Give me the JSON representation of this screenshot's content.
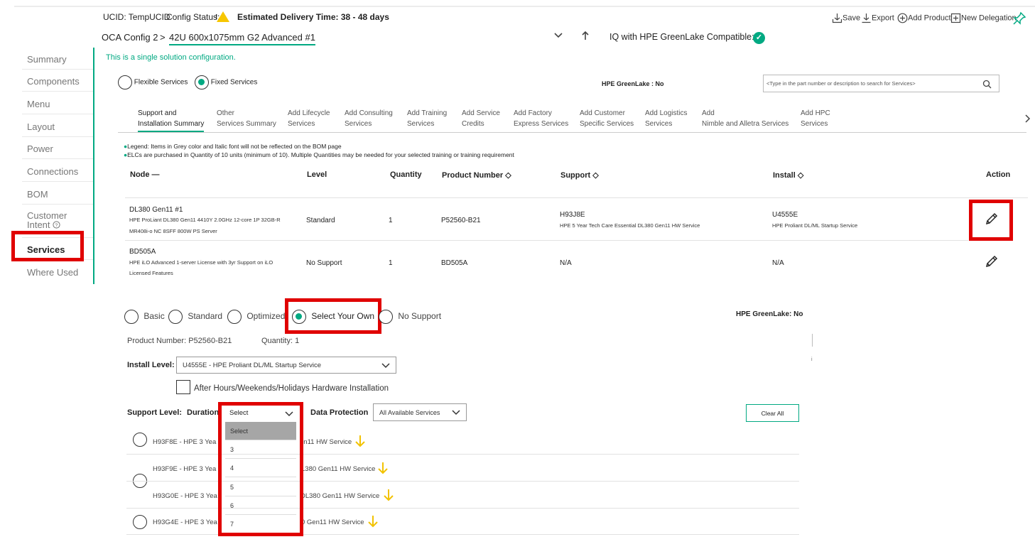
{
  "header": {
    "ucid_label": "UCID: TempUCID",
    "config_status_label": "Config Status:",
    "delivery_label": "Estimated Delivery Time: 38 - 48 days",
    "config_name": "OCA Config 2",
    "breadcrumb_sep": ">",
    "rack_name": "42U 600x1075mm G2 Advanced #1",
    "iq_label": "IQ with HPE GreenLake Compatible:",
    "single_solution_note": "This is a single solution configuration.",
    "toolbar": {
      "save": "Save",
      "export": "Export",
      "add_product": "Add Product",
      "new_delegation": "New Delegation"
    }
  },
  "sidebar": {
    "items": [
      {
        "label": "Summary"
      },
      {
        "label": "Components"
      },
      {
        "label": "Menu"
      },
      {
        "label": "Layout"
      },
      {
        "label": "Power"
      },
      {
        "label": "Connections"
      },
      {
        "label": "BOM"
      },
      {
        "label": "Customer",
        "label2": "Intent"
      },
      {
        "label": "Services"
      },
      {
        "label": "Where Used"
      }
    ]
  },
  "services": {
    "flexible_label": "Flexible Services",
    "fixed_label": "Fixed Services",
    "greenlake_label": "HPE GreenLake : No",
    "search_placeholder": "<Type in the part number or description to search for Services>",
    "tabs": [
      {
        "l1": "Support and",
        "l2": "Installation Summary"
      },
      {
        "l1": "Other",
        "l2": "Services Summary"
      },
      {
        "l1": "Add Lifecycle",
        "l2": "Services"
      },
      {
        "l1": "Add Consulting",
        "l2": "Services"
      },
      {
        "l1": "Add Training",
        "l2": "Services"
      },
      {
        "l1": "Add Service",
        "l2": "Credits"
      },
      {
        "l1": "Add Factory",
        "l2": "Express Services"
      },
      {
        "l1": "Add Customer",
        "l2": "Specific Services"
      },
      {
        "l1": "Add Logistics",
        "l2": "Services"
      },
      {
        "l1": "Add",
        "l2": "Nimble and Alletra Services"
      },
      {
        "l1": "Add HPC",
        "l2": "Services"
      }
    ],
    "legend1": "Legend: Items in Grey color and Italic font will not be reflected on the BOM page",
    "legend2": "ELCs are purchased in Quantity of 10 units (minimum of 10). Multiple Quantities may be needed for your selected training or training requirement",
    "table": {
      "headers": {
        "node": "Node —",
        "level": "Level",
        "quantity": "Quantity",
        "product_number": "Product Number ◇",
        "support": "Support ◇",
        "install": "Install ◇",
        "action": "Action"
      },
      "rows": [
        {
          "node": "DL380 Gen11 #1",
          "desc1": "HPE ProLiant DL380 Gen11 4410Y 2.0GHz 12-core 1P 32GB-R",
          "desc2": "MR408i-o NC 8SFF 800W PS Server",
          "level": "Standard",
          "quantity": "1",
          "product_number": "P52560-B21",
          "support_code": "H93J8E",
          "support_desc": "HPE 5 Year Tech Care Essential DL380 Gen11 HW Service",
          "install_code": "U4555E",
          "install_desc": "HPE Proliant DL/ML Startup Service"
        },
        {
          "node": "BD505A",
          "desc1": "HPE iLO Advanced 1-server License with 3yr Support on iLO",
          "desc2": "Licensed Features",
          "level": "No Support",
          "quantity": "1",
          "product_number": "BD505A",
          "support_code": "N/A",
          "support_desc": "",
          "install_code": "N/A",
          "install_desc": ""
        }
      ]
    }
  },
  "detail": {
    "levels": [
      "Basic",
      "Standard",
      "Optimized",
      "Select Your Own",
      "No Support"
    ],
    "greenlake_label": "HPE GreenLake:  No",
    "product_number_label": "Product Number: P52560-B21",
    "quantity_label": "Quantity: 1",
    "install_level_label": "Install Level:",
    "install_level_value": "U4555E - HPE Proliant DL/ML Startup Service",
    "after_hours_label": "After Hours/Weekends/Holidays Hardware Installation",
    "support_level_label": "Support Level:",
    "duration_label": "Duration",
    "duration_value": "Select",
    "duration_options": [
      "Select",
      "3",
      "4",
      "5",
      "6",
      "7"
    ],
    "data_protection_label": "Data Protection",
    "data_protection_value": "All Available Services",
    "clear_all": "Clear All",
    "service_rows": [
      {
        "code": "H93F8E - HPE 3 Yea",
        "tail": "en11 HW Service"
      },
      {
        "code": "H93F9E - HPE 3 Yea",
        "tail": "L380 Gen11 HW Service"
      },
      {
        "code": "H93G0E - HPE 3 Yea",
        "tail": "DL380 Gen11 HW Service"
      },
      {
        "code": "H93G4E - HPE 3 Yea",
        "tail": "0 Gen11 HW Service"
      }
    ],
    "side_mark": "i"
  },
  "colors": {
    "accent": "#01a982",
    "highlight": "#e00000",
    "warning": "#f7c600",
    "arrow": "#f2c200"
  }
}
